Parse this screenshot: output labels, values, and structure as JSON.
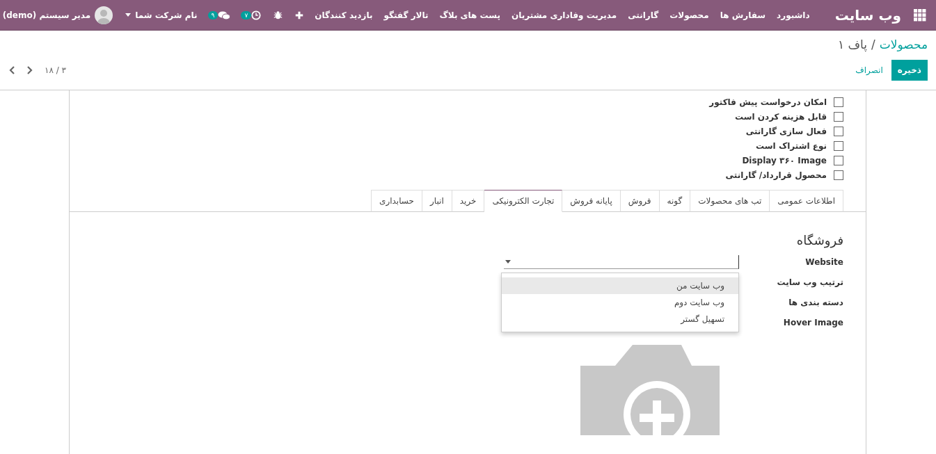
{
  "navbar": {
    "brand": "وب سایت",
    "menu": [
      "داشبورد",
      "سفارش ها",
      "محصولات",
      "گارانتی",
      "مدیریت وفاداری مشتریان",
      "پست های بلاگ",
      "تالار گفتگو",
      "بازدید کنندگان"
    ],
    "activity_badge": "۷",
    "messages_badge": "۹",
    "company": "نام شرکت شما",
    "user": "مدیر سیستم (demo)"
  },
  "breadcrumb": {
    "parent": "محصولات",
    "separator": "/",
    "current": "پاف ۱"
  },
  "actions": {
    "save": "ذخیره",
    "discard": "انصراف"
  },
  "pager": {
    "value": "۳ / ۱۸"
  },
  "options": [
    {
      "label": "امکان درخواست پیش فاکتور",
      "checked": false
    },
    {
      "label": "قابل هزینه کردن است",
      "checked": false
    },
    {
      "label": "فعال سازی گارانتی",
      "checked": false
    },
    {
      "label": "نوع اشتراک است",
      "checked": false
    },
    {
      "label": "Display ۳۶۰ Image",
      "checked": false
    },
    {
      "label": "محصول قرارداد/ گارانتی",
      "checked": false
    }
  ],
  "tabs": [
    {
      "label": "اطلاعات عمومی",
      "selected": false
    },
    {
      "label": "تب های محصولات",
      "selected": false
    },
    {
      "label": "گونه",
      "selected": false
    },
    {
      "label": "فروش",
      "selected": false
    },
    {
      "label": "پایانه فروش",
      "selected": false
    },
    {
      "label": "تجارت الکترونیکی",
      "selected": true
    },
    {
      "label": "خرید",
      "selected": false
    },
    {
      "label": "انبار",
      "selected": false
    },
    {
      "label": "حسابداری",
      "selected": false
    }
  ],
  "shop": {
    "title": "فروشگاه",
    "fields": [
      {
        "label": "Website",
        "kind": "select"
      },
      {
        "label": "ترتیب وب سایت",
        "kind": "text"
      },
      {
        "label": "دسته بندی ها",
        "kind": "text"
      },
      {
        "label": "Hover Image",
        "kind": "image"
      }
    ],
    "dropdown": [
      {
        "label": "وب سایت من",
        "selected": true
      },
      {
        "label": "وب سایت دوم",
        "selected": false
      },
      {
        "label": "تسهیل گستر",
        "selected": false
      }
    ]
  }
}
